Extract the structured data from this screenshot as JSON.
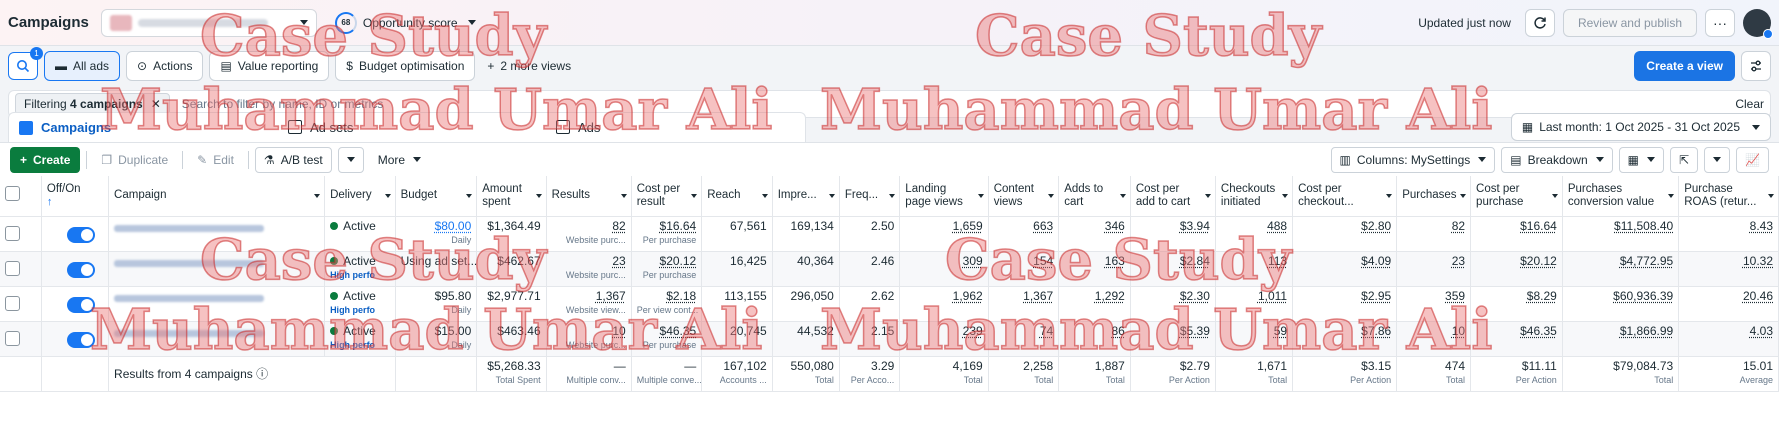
{
  "topbar": {
    "title": "Campaigns",
    "opportunity_score": "68",
    "opportunity_label": "Opportunity score",
    "updated": "Updated just now",
    "review_publish": "Review and publish",
    "more": "···"
  },
  "views": {
    "badge": "1",
    "all_ads": "All ads",
    "actions": "Actions",
    "value_reporting": "Value reporting",
    "budget_optimisation": "Budget optimisation",
    "more_views": "2 more views",
    "create_view": "Create a view"
  },
  "filter": {
    "prefix": "Filtering",
    "bold": "4 campaigns",
    "placeholder": "Search to filter by name, ID or metrics",
    "clear": "Clear"
  },
  "levels": {
    "campaigns": "Campaigns",
    "ad_sets": "Ad sets",
    "ads": "Ads",
    "date_range": "Last month: 1 Oct 2025 - 31 Oct 2025"
  },
  "toolbar": {
    "create": "Create",
    "duplicate": "Duplicate",
    "edit": "Edit",
    "ab_test": "A/B test",
    "more": "More",
    "columns": "Columns: MySettings",
    "breakdown": "Breakdown"
  },
  "table": {
    "headers": {
      "off_on": "Off/On",
      "campaign": "Campaign",
      "delivery": "Delivery",
      "budget": "Budget",
      "amount_spent": "Amount spent",
      "results": "Results",
      "cost_per_result": "Cost per result",
      "reach": "Reach",
      "impressions": "Impre...",
      "frequency": "Freq...",
      "landing_page_views": "Landing page views",
      "content_views": "Content views",
      "adds_to_cart": "Adds to cart",
      "cost_per_add_to_cart": "Cost per add to cart",
      "checkouts_initiated": "Checkouts initiated",
      "cost_per_checkout": "Cost per checkout...",
      "purchases": "Purchases",
      "cost_per_purchase": "Cost per purchase",
      "purchases_conversion_value": "Purchases conversion value",
      "purchase_roas": "Purchase ROAS (retur..."
    },
    "rows": [
      {
        "delivery": "Active",
        "delivery_sub": "",
        "budget": "$80.00",
        "budget_sub": "Daily",
        "amount_spent": "$1,364.49",
        "results": "82",
        "results_sub": "Website purc...",
        "cost_per_result": "$16.64",
        "cpr_sub": "Per purchase",
        "reach": "67,561",
        "impressions": "169,134",
        "frequency": "2.50",
        "lpv": "1,659",
        "content_views": "663",
        "adds_to_cart": "346",
        "cost_atc": "$3.94",
        "checkouts": "488",
        "cost_checkout": "$2.80",
        "purchases": "82",
        "cost_purchase": "$16.64",
        "conv_value": "$11,508.40",
        "roas": "8.43"
      },
      {
        "delivery": "Active",
        "delivery_sub": "High perfo",
        "budget": "Using ad set...",
        "budget_sub": "",
        "amount_spent": "$462.67",
        "results": "23",
        "results_sub": "Website purc...",
        "cost_per_result": "$20.12",
        "cpr_sub": "Per purchase",
        "reach": "16,425",
        "impressions": "40,364",
        "frequency": "2.46",
        "lpv": "309",
        "content_views": "154",
        "adds_to_cart": "163",
        "cost_atc": "$2.84",
        "checkouts": "113",
        "cost_checkout": "$4.09",
        "purchases": "23",
        "cost_purchase": "$20.12",
        "conv_value": "$4,772.95",
        "roas": "10.32"
      },
      {
        "delivery": "Active",
        "delivery_sub": "High perfo",
        "budget": "$95.80",
        "budget_sub": "Daily",
        "amount_spent": "$2,977.71",
        "results": "1,367",
        "results_sub": "Website view...",
        "cost_per_result": "$2.18",
        "cpr_sub": "Per view cont...",
        "reach": "113,155",
        "impressions": "296,050",
        "frequency": "2.62",
        "lpv": "1,962",
        "content_views": "1,367",
        "adds_to_cart": "1,292",
        "cost_atc": "$2.30",
        "checkouts": "1,011",
        "cost_checkout": "$2.95",
        "purchases": "359",
        "cost_purchase": "$8.29",
        "conv_value": "$60,936.39",
        "roas": "20.46"
      },
      {
        "delivery": "Active",
        "delivery_sub": "High perfo",
        "budget": "$15.00",
        "budget_sub": "Daily",
        "amount_spent": "$463.46",
        "results": "10",
        "results_sub": "Website purc...",
        "cost_per_result": "$46.35",
        "cpr_sub": "Per purchase",
        "reach": "20,745",
        "impressions": "44,532",
        "frequency": "2.15",
        "lpv": "239",
        "content_views": "74",
        "adds_to_cart": "86",
        "cost_atc": "$5.39",
        "checkouts": "59",
        "cost_checkout": "$7.86",
        "purchases": "10",
        "cost_purchase": "$46.35",
        "conv_value": "$1,866.99",
        "roas": "4.03"
      }
    ],
    "summary": {
      "label": "Results from 4 campaigns",
      "amount_spent": "$5,268.33",
      "amount_spent_sub": "Total Spent",
      "results": "—",
      "results_sub": "Multiple conv...",
      "cost_per_result": "—",
      "cpr_sub": "Multiple conve...",
      "reach": "167,102",
      "reach_sub": "Accounts ...",
      "impressions": "550,080",
      "impressions_sub": "Total",
      "frequency": "3.29",
      "frequency_sub": "Per Acco...",
      "lpv": "4,169",
      "lpv_sub": "Total",
      "content_views": "2,258",
      "content_views_sub": "Total",
      "adds_to_cart": "1,887",
      "adds_to_cart_sub": "Total",
      "cost_atc": "$2.79",
      "cost_atc_sub": "Per Action",
      "checkouts": "1,671",
      "checkouts_sub": "Total",
      "cost_checkout": "$3.15",
      "cost_checkout_sub": "Per Action",
      "purchases": "474",
      "purchases_sub": "Total",
      "cost_purchase": "$11.11",
      "cost_purchase_sub": "Per Action",
      "conv_value": "$79,084.73",
      "conv_value_sub": "Total",
      "roas": "15.01",
      "roas_sub": "Average"
    }
  },
  "watermark": {
    "line1": "Case Study",
    "line2": "Muhammad Umar Ali"
  },
  "colors": {
    "accent": "#1877f2",
    "create_green": "#0a7c3e",
    "watermark": "#e07878"
  }
}
